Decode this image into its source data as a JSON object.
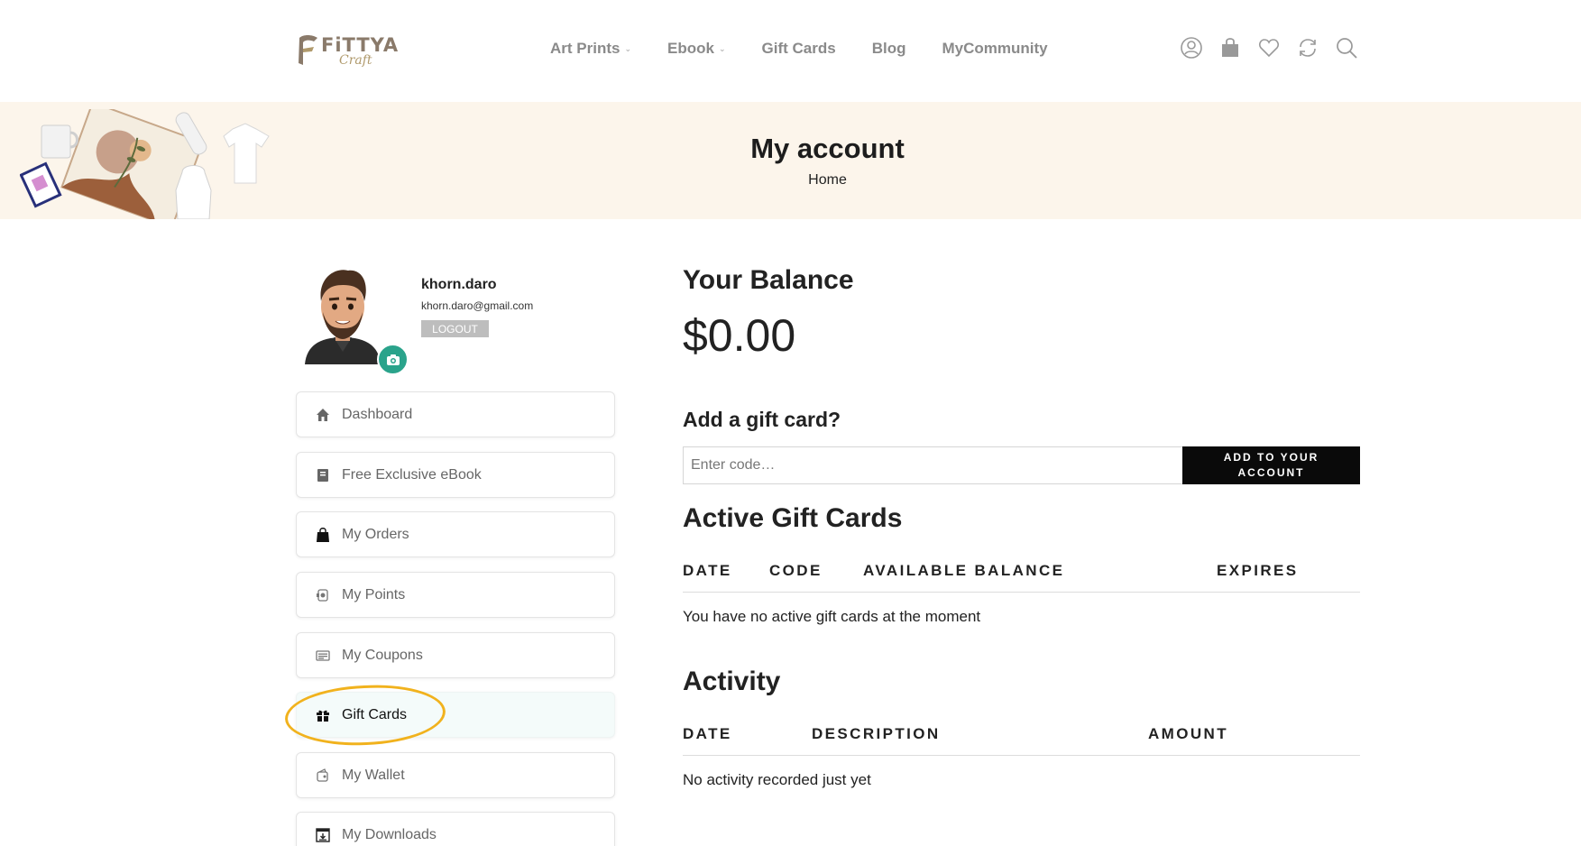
{
  "brand": {
    "name": "FiTTYA",
    "sub": "Craft",
    "accent": "#2aa38b"
  },
  "nav": [
    {
      "label": "Art Prints",
      "has_dropdown": true
    },
    {
      "label": "Ebook",
      "has_dropdown": true
    },
    {
      "label": "Gift Cards",
      "has_dropdown": false
    },
    {
      "label": "Blog",
      "has_dropdown": false
    },
    {
      "label": "MyCommunity",
      "has_dropdown": false
    }
  ],
  "header_icons": [
    "account-icon",
    "shopping-bag-icon",
    "heart-icon",
    "compare-icon",
    "search-icon"
  ],
  "banner": {
    "title": "My account",
    "breadcrumb": "Home"
  },
  "profile": {
    "username": "khorn.daro",
    "email": "khorn.daro@gmail.com",
    "logout_label": "LOGOUT"
  },
  "menu": [
    {
      "label": "Dashboard",
      "icon": "home-icon",
      "active": false
    },
    {
      "label": "Free Exclusive eBook",
      "icon": "book-icon",
      "active": false
    },
    {
      "label": "My Orders",
      "icon": "shopping-bag-icon",
      "active": false
    },
    {
      "label": "My Points",
      "icon": "points-icon",
      "active": false
    },
    {
      "label": "My Coupons",
      "icon": "coupon-icon",
      "active": false
    },
    {
      "label": "Gift Cards",
      "icon": "gift-icon",
      "active": true
    },
    {
      "label": "My Wallet",
      "icon": "wallet-icon",
      "active": false
    },
    {
      "label": "My Downloads",
      "icon": "download-icon",
      "active": false
    }
  ],
  "balance": {
    "title": "Your Balance",
    "value": "$0.00"
  },
  "add_gift_card": {
    "title": "Add a gift card?",
    "placeholder": "Enter code…",
    "button_label": "ADD TO YOUR ACCOUNT"
  },
  "active_cards": {
    "title": "Active Gift Cards",
    "columns": [
      "DATE",
      "CODE",
      "AVAILABLE BALANCE",
      "EXPIRES"
    ],
    "empty_message": "You have no active gift cards at the moment"
  },
  "activity": {
    "title": "Activity",
    "columns": [
      "DATE",
      "DESCRIPTION",
      "AMOUNT"
    ],
    "empty_message": "No activity recorded just yet"
  },
  "colors": {
    "highlight": "#f1b21d",
    "banner_bg": "#fcf5eb",
    "button_bg": "#0a0a0a"
  }
}
